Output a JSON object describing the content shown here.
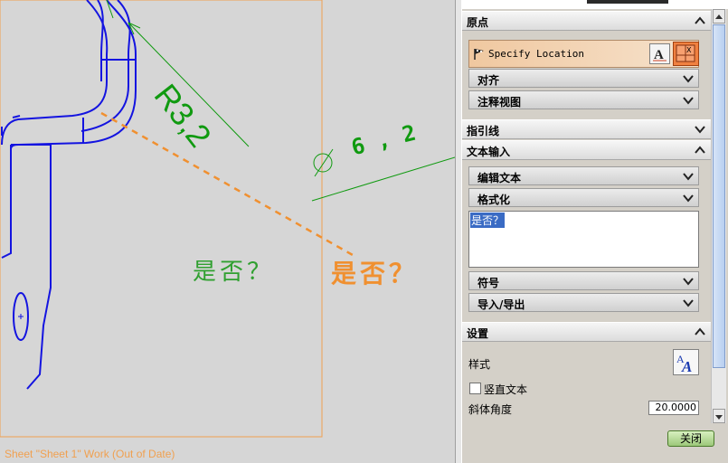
{
  "canvas": {
    "radius_label": "R3,2",
    "diameter_value": "6 , 2",
    "diameter_symbol": "⌀",
    "annotation_text": "是否？",
    "annotation_preview": "是否？",
    "sheet_status": "Sheet \"Sheet 1\" Work (Out of Date)",
    "colors": {
      "geometry": "#1010e0",
      "dimension": "#109a10",
      "preview": "#f09030",
      "background": "#d6d6d6"
    }
  },
  "panel": {
    "origin": {
      "label": "原点",
      "specify_location": "Specify Location",
      "align": "对齐",
      "annotation_view": "注释视图"
    },
    "leader": {
      "label": "指引线"
    },
    "text_input": {
      "label": "文本输入",
      "edit_text": "编辑文本",
      "format": "格式化",
      "text_value": "是否？",
      "symbols": "符号",
      "import_export": "导入/导出"
    },
    "settings": {
      "label": "设置",
      "style": "样式",
      "vertical_text": "竖直文本",
      "slant_angle_label": "斜体角度",
      "slant_angle_value": "20.0000"
    },
    "close_button": "关闭"
  }
}
